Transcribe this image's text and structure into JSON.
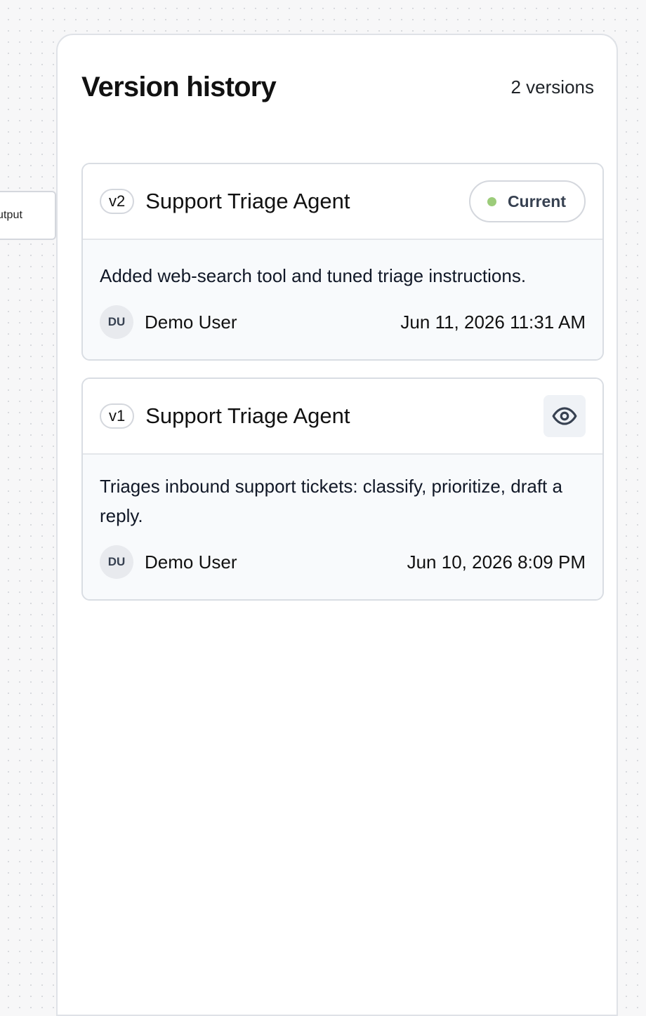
{
  "canvas": {
    "node_label": "utput"
  },
  "panel": {
    "title": "Version history",
    "count_label": "2 versions"
  },
  "versions": [
    {
      "tag": "v2",
      "name": "Support Triage Agent",
      "status": "Current",
      "description": "Added web-search tool and tuned triage instructions.",
      "author_initials": "DU",
      "author": "Demo User",
      "timestamp": "Jun 11, 2026 11:31 AM"
    },
    {
      "tag": "v1",
      "name": "Support Triage Agent",
      "action_icon": "eye-icon",
      "description": "Triages inbound support tickets: classify, prioritize, draft a reply.",
      "author_initials": "DU",
      "author": "Demo User",
      "timestamp": "Jun 10, 2026 8:09 PM"
    }
  ],
  "colors": {
    "current_dot": "#9ccc7a",
    "card_body_bg": "#f8fafc",
    "border": "#d9dde3"
  }
}
